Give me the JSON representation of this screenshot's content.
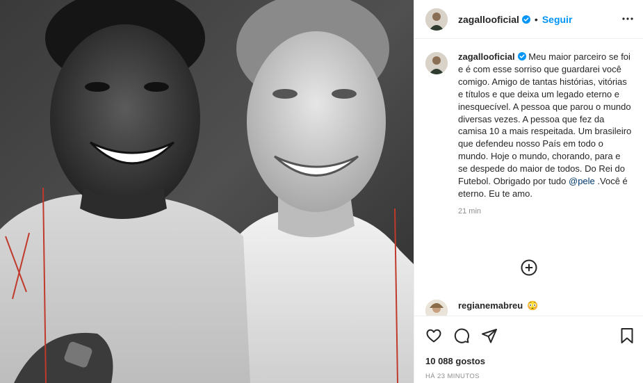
{
  "post": {
    "username": "zagallooficial",
    "follow_label": "Seguir",
    "separator": "•"
  },
  "caption": {
    "username": "zagallooficial",
    "text_before_mention": " Meu maior parceiro se foi e é com esse sorriso que guardarei você comigo. Amigo de tantas histórias, vitórias e títulos e que deixa um legado eterno e inesquecível. A pessoa que parou o mundo diversas vezes. A pessoa que fez da camisa 10 a mais respeitada. Um brasileiro que defendeu nosso País em todo o mundo. Hoje o mundo, chorando, para e se despede do maior de todos. Do Rei do Futebol. Obrigado por tudo ",
    "mention": "@pele",
    "text_after_mention": " .Você é eterno. Eu te amo.",
    "time": "21 min"
  },
  "comment": {
    "username": "regianemabreu",
    "emoji": "😳"
  },
  "actions": {
    "likes": "10 088 gostos",
    "date": "HÁ 23 MINUTOS"
  },
  "colors": {
    "accent": "#0095f6",
    "mention": "#00376b",
    "verified": "#0095f6",
    "muted": "#8e8e8e"
  },
  "icons": [
    "verified-badge-icon",
    "more-options-icon",
    "load-more-icon",
    "heart-icon",
    "comment-icon",
    "share-icon",
    "bookmark-icon"
  ]
}
